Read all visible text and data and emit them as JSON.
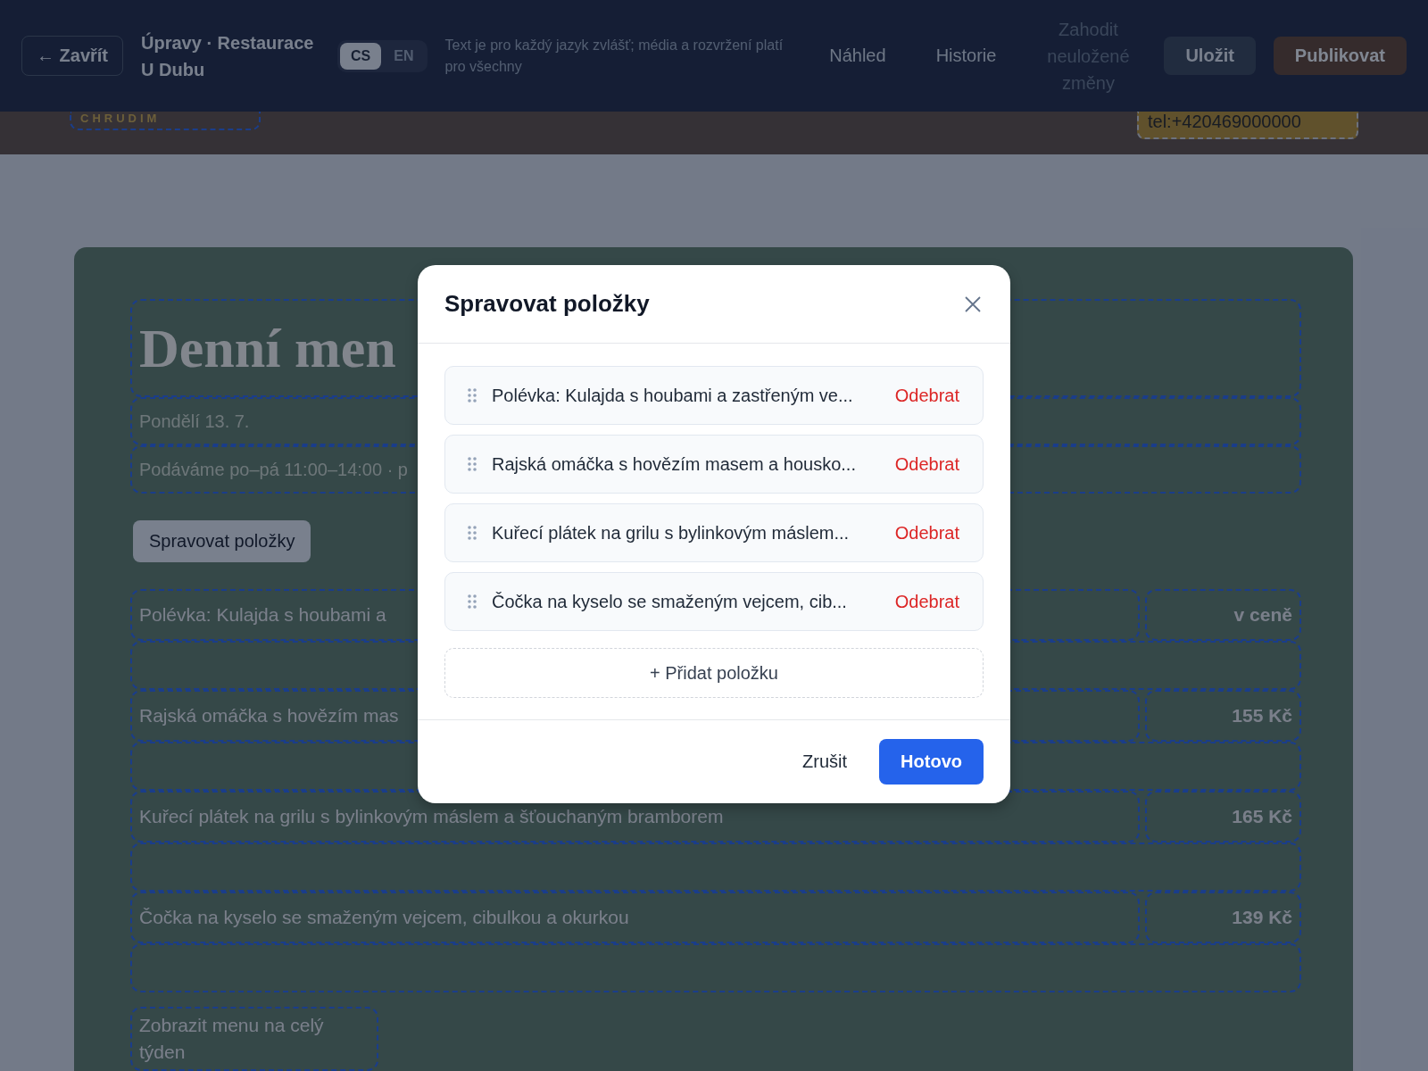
{
  "top_bar": {
    "close_button": "← Zavřít",
    "title": "Úpravy · Restaurace U Dubu",
    "languages": [
      {
        "label": "CS",
        "selected": true
      },
      {
        "label": "EN",
        "selected": false
      }
    ],
    "hint": "Text je pro každý jazyk zvlášť; média a rozvržení platí pro všechny",
    "actions": [
      {
        "label": "Náhled",
        "kind": "link",
        "disabled": false
      },
      {
        "label": "Historie",
        "kind": "link",
        "disabled": false
      },
      {
        "label": "Zahodit neuložené změny",
        "kind": "link",
        "disabled": true
      },
      {
        "label": "Uložit",
        "kind": "secondary",
        "disabled": false
      },
      {
        "label": "Publikovat",
        "kind": "primary",
        "disabled": false
      }
    ]
  },
  "page_header": {
    "badge": "CHRUDIM",
    "phone": "tel:+420469000000"
  },
  "menu_card": {
    "title": "Denní men",
    "date": "Pondělí 13. 7.",
    "note": "Podáváme po–pá 11:00–14:00 · p",
    "manage_button": "Spravovat položky",
    "items": [
      {
        "name": "Polévka: Kulajda s houbami a",
        "price": "v ceně"
      },
      {
        "name": "Rajská omáčka s hovězím mas",
        "price": "155 Kč"
      },
      {
        "name": "Kuřecí plátek na grilu s bylinkovým máslem a šťouchaným bramborem",
        "price": "165 Kč"
      },
      {
        "name": "Čočka na kyselo se smaženým vejcem, cibulkou a okurkou",
        "price": "139 Kč"
      }
    ],
    "more_link": "Zobrazit menu na celý týden"
  },
  "modal": {
    "title": "Spravovat položky",
    "items": [
      {
        "label": "Polévka: Kulajda s houbami a zastřeným ve...",
        "remove": "Odebrat"
      },
      {
        "label": "Rajská omáčka s hovězím masem a housko...",
        "remove": "Odebrat"
      },
      {
        "label": "Kuřecí plátek na grilu s bylinkovým máslem...",
        "remove": "Odebrat"
      },
      {
        "label": "Čočka na kyselo se smaženým vejcem, cib...",
        "remove": "Odebrat"
      }
    ],
    "add_button": "+ Přidat položku",
    "cancel_button": "Zrušit",
    "done_button": "Hotovo"
  }
}
